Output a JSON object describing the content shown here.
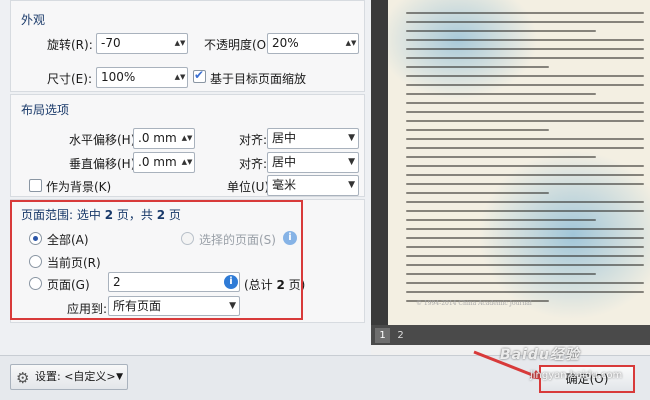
{
  "appearance": {
    "title": "外观",
    "rotation_label": "旋转(R):",
    "rotation_value": "-70",
    "opacity_label": "不透明度(O):",
    "opacity_value": "20%",
    "size_label": "尺寸(E):",
    "size_value": "100%",
    "scale_checkbox_label": "基于目标页面缩放",
    "scale_checked": true
  },
  "layout": {
    "title": "布局选项",
    "h_offset_label": "水平偏移(H):",
    "h_offset_value": ".0 mm",
    "v_offset_label": "垂直偏移(H):",
    "v_offset_value": ".0 mm",
    "align_label_1": "对齐:",
    "align_value_1": "居中",
    "align_label_2": "对齐:",
    "align_value_2": "居中",
    "background_label": "作为背景(K)",
    "unit_label": "单位(U):",
    "unit_value": "毫米"
  },
  "page_range": {
    "summary_prefix": "页面范围: 选中 ",
    "selected_count": "2",
    "summary_mid": " 页，共 ",
    "total_count": "2",
    "summary_suffix": " 页",
    "all_label": "全部(A)",
    "selected_pages_label": "选择的页面(S)",
    "current_label": "当前页(R)",
    "pages_label": "页面(G)",
    "pages_value": "2",
    "total_note_prefix": "(总计 ",
    "total_note_count": "2",
    "total_note_suffix": " 页)",
    "apply_label": "应用到:",
    "apply_value": "所有页面"
  },
  "bottom": {
    "settings_label": "设置: <自定义>",
    "ok_label": "确定(O)"
  },
  "preview": {
    "pages": [
      "1",
      "2"
    ],
    "copyright": "© 1994-2014 China Academic Journal"
  },
  "watermark": {
    "brand": "Baidu经验",
    "url": "jingyan.baidu.com"
  },
  "colors": {
    "highlight_border": "#d83a3a",
    "info_icon": "#2f7bd6"
  }
}
